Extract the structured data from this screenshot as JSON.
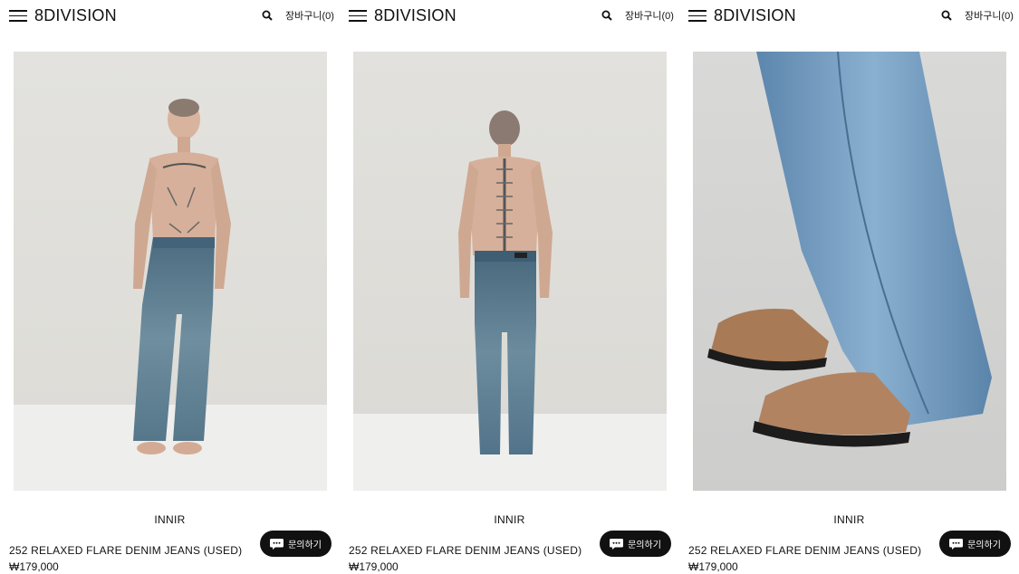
{
  "colors": {
    "background": "#ffffff",
    "text": "#111111",
    "button_bg": "#111111",
    "button_text": "#ffffff"
  },
  "panels": [
    {
      "header": {
        "logo": "8DIVISION",
        "cart": "장바구니(0)",
        "menu_icon": "hamburger-menu-icon",
        "search_icon": "search-icon"
      },
      "photo": {
        "subject": "front"
      },
      "product": {
        "brand": "INNIR",
        "name": "252 RELAXED FLARE DENIM JEANS (USED)",
        "price": "₩179,000"
      },
      "inquiry": {
        "label": "문의하기",
        "icon": "chat-bubble-icon"
      }
    },
    {
      "header": {
        "logo": "8DIVISION",
        "cart": "장바구니(0)",
        "menu_icon": "hamburger-menu-icon",
        "search_icon": "search-icon"
      },
      "photo": {
        "subject": "back"
      },
      "product": {
        "brand": "INNIR",
        "name": "252 RELAXED FLARE DENIM JEANS (USED)",
        "price": "₩179,000"
      },
      "inquiry": {
        "label": "문의하기",
        "icon": "chat-bubble-icon"
      }
    },
    {
      "header": {
        "logo": "8DIVISION",
        "cart": "장바구니(0)",
        "menu_icon": "hamburger-menu-icon",
        "search_icon": "search-icon"
      },
      "photo": {
        "subject": "detail"
      },
      "product": {
        "brand": "INNIR",
        "name": "252 RELAXED FLARE DENIM JEANS (USED)",
        "price": "₩179,000"
      },
      "inquiry": {
        "label": "문의하기",
        "icon": "chat-bubble-icon"
      }
    }
  ]
}
